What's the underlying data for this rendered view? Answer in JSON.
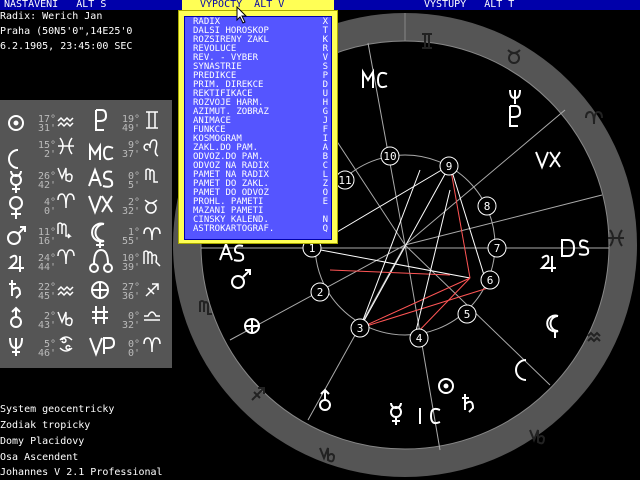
{
  "menubar": {
    "items": [
      {
        "label": "NASTAVENI   ALT S"
      },
      {
        "label": "VYPOCTY  ALT V"
      },
      {
        "label": "VYSTUPY   ALT T"
      }
    ]
  },
  "chart_info": {
    "line1": "Radix: Werich Jan",
    "line2": "Praha (50N5'0\",14E25'0",
    "line3": "6.2.1905, 23:45:00 SEC"
  },
  "planets": [
    {
      "glyph": "sun-icon",
      "deg": "17°",
      "min": "31'",
      "sign": "aquarius-icon"
    },
    {
      "glyph": "moon-icon",
      "deg": "15°",
      "min": "2'",
      "sign": "pisces-icon"
    },
    {
      "glyph": "mercury-icon",
      "deg": "26°",
      "min": "42'",
      "sign": "capricorn-icon"
    },
    {
      "glyph": "venus-icon",
      "deg": "4°",
      "min": "0'",
      "sign": "aries-icon"
    },
    {
      "glyph": "mars-icon",
      "deg": "11°",
      "min": "16'",
      "sign": "scorpio-icon"
    },
    {
      "glyph": "jupiter-icon",
      "deg": "24°",
      "min": "44'",
      "sign": "aries-icon"
    },
    {
      "glyph": "saturn-icon",
      "deg": "22°",
      "min": "45'",
      "sign": "aquarius-icon"
    },
    {
      "glyph": "uranus-icon",
      "deg": "2°",
      "min": "43'",
      "sign": "capricorn-icon"
    },
    {
      "glyph": "neptune-icon",
      "deg": "5°",
      "min": "46'",
      "sign": "cancer-icon"
    }
  ],
  "points": [
    {
      "glyph": "pluto-icon",
      "deg": "19°",
      "min": "49'",
      "sign": "gemini-icon"
    },
    {
      "glyph": "mc-icon",
      "deg": "9°",
      "min": "37'",
      "sign": "leo-icon"
    },
    {
      "glyph": "as-icon",
      "deg": "0°",
      "min": "5'",
      "sign": "scorpio-icon"
    },
    {
      "glyph": "vx-icon",
      "deg": "2°",
      "min": "32'",
      "sign": "taurus-icon"
    },
    {
      "glyph": "lilith-icon",
      "deg": "1°",
      "min": "55'",
      "sign": "aries-icon"
    },
    {
      "glyph": "node-icon",
      "deg": "10°",
      "min": "39'",
      "sign": "virgo-icon"
    },
    {
      "glyph": "fortune-icon",
      "deg": "27°",
      "min": "36'",
      "sign": "sagittarius-icon"
    },
    {
      "glyph": "vertex-cross-icon",
      "deg": "0°",
      "min": "32'",
      "sign": "libra-icon"
    },
    {
      "glyph": "vp-icon",
      "deg": "0°",
      "min": "0'",
      "sign": "aries-icon"
    }
  ],
  "dropdown": {
    "items": [
      {
        "label": "RADIX",
        "key": "X"
      },
      {
        "label": "DALSI HOROSKOP",
        "key": "T"
      },
      {
        "label": "ROZSIRENY ZAKL",
        "key": "K"
      },
      {
        "label": "REVOLUCE",
        "key": "R"
      },
      {
        "label": "REV. - VYBER",
        "key": "V"
      },
      {
        "label": "SYNASTRIE",
        "key": "S"
      },
      {
        "label": "PREDIKCE",
        "key": "P"
      },
      {
        "label": "PRIM. DIREKCE",
        "key": "D"
      },
      {
        "label": "REKTIFIKACE",
        "key": "U"
      },
      {
        "label": "ROZVOJE HARM.",
        "key": "H"
      },
      {
        "label": "AZIMUT. ZOBRAZ",
        "key": "G"
      },
      {
        "label": "ANIMACE",
        "key": "J"
      },
      {
        "label": "FUNKCE",
        "key": "F"
      },
      {
        "label": "KOSMOGRAM",
        "key": "I"
      },
      {
        "label": "ZAKL.DO PAM.",
        "key": "A"
      },
      {
        "label": "ODVOZ.DO PAM.",
        "key": "B"
      },
      {
        "label": "ODVOZ NA RADIX",
        "key": "C"
      },
      {
        "label": "PAMET NA RADIX",
        "key": "L"
      },
      {
        "label": "PAMET DO ZAKL.",
        "key": "Z"
      },
      {
        "label": "PAMET DO ODVOZ",
        "key": "O"
      },
      {
        "label": "PROHL. PAMETI",
        "key": "E"
      },
      {
        "label": "MAZANI PAMETI",
        "key": ""
      },
      {
        "label": "CINSKY KALEND.",
        "key": "N"
      },
      {
        "label": "ASTROKARTOGRAF.",
        "key": "Q"
      }
    ]
  },
  "status": {
    "line1": "System geocentricky",
    "line2": "Zodiak tropicky",
    "line3": "Domy Placidovy",
    "line4": "Osa Ascendent",
    "line5": "Johannes V 2.1 Professional"
  },
  "wheel": {
    "angles": [
      "MC",
      "VX",
      "DS",
      "AS",
      "IC"
    ],
    "houses": [
      "1",
      "2",
      "3",
      "4",
      "5",
      "6",
      "7",
      "8",
      "9",
      "10",
      "11"
    ]
  }
}
